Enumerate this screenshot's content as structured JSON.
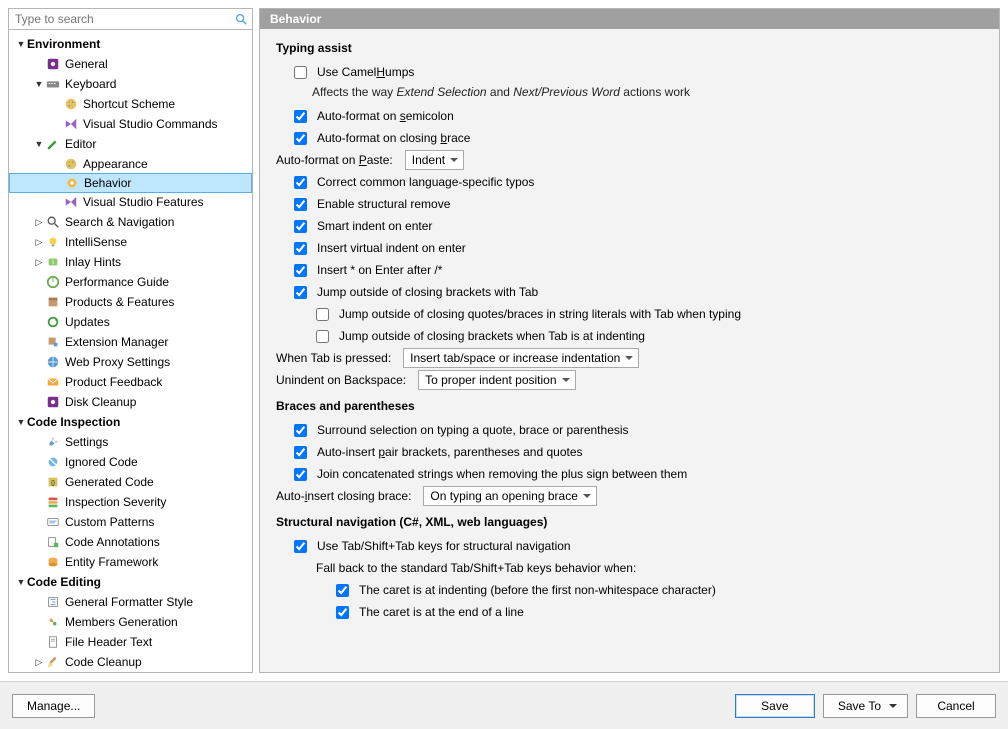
{
  "search": {
    "placeholder": "Type to search"
  },
  "header": {
    "title": "Behavior"
  },
  "tree": {
    "items": [
      {
        "level": 0,
        "arrow": "down",
        "bold": true,
        "label": "Environment",
        "icon": "none"
      },
      {
        "level": 1,
        "arrow": "none",
        "bold": false,
        "label": "General",
        "icon": "gear-red"
      },
      {
        "level": 1,
        "arrow": "down",
        "bold": false,
        "label": "Keyboard",
        "icon": "keyboard"
      },
      {
        "level": 2,
        "arrow": "none",
        "bold": false,
        "label": "Shortcut Scheme",
        "icon": "palette"
      },
      {
        "level": 2,
        "arrow": "none",
        "bold": false,
        "label": "Visual Studio Commands",
        "icon": "vs"
      },
      {
        "level": 1,
        "arrow": "down",
        "bold": false,
        "label": "Editor",
        "icon": "pencil"
      },
      {
        "level": 2,
        "arrow": "none",
        "bold": false,
        "label": "Appearance",
        "icon": "palette"
      },
      {
        "level": 2,
        "arrow": "none",
        "bold": false,
        "label": "Behavior",
        "icon": "gear-yellow",
        "selected": true
      },
      {
        "level": 2,
        "arrow": "none",
        "bold": false,
        "label": "Visual Studio Features",
        "icon": "vs"
      },
      {
        "level": 1,
        "arrow": "right",
        "bold": false,
        "label": "Search & Navigation",
        "icon": "search"
      },
      {
        "level": 1,
        "arrow": "right",
        "bold": false,
        "label": "IntelliSense",
        "icon": "bulb"
      },
      {
        "level": 1,
        "arrow": "right",
        "bold": false,
        "label": "Inlay Hints",
        "icon": "hint"
      },
      {
        "level": 1,
        "arrow": "none",
        "bold": false,
        "label": "Performance Guide",
        "icon": "perf"
      },
      {
        "level": 1,
        "arrow": "none",
        "bold": false,
        "label": "Products & Features",
        "icon": "box"
      },
      {
        "level": 1,
        "arrow": "none",
        "bold": false,
        "label": "Updates",
        "icon": "refresh"
      },
      {
        "level": 1,
        "arrow": "none",
        "bold": false,
        "label": "Extension Manager",
        "icon": "ext"
      },
      {
        "level": 1,
        "arrow": "none",
        "bold": false,
        "label": "Web Proxy Settings",
        "icon": "globe"
      },
      {
        "level": 1,
        "arrow": "none",
        "bold": false,
        "label": "Product Feedback",
        "icon": "mail"
      },
      {
        "level": 1,
        "arrow": "none",
        "bold": false,
        "label": "Disk Cleanup",
        "icon": "gear-red"
      },
      {
        "level": 0,
        "arrow": "down",
        "bold": true,
        "label": "Code Inspection",
        "icon": "none"
      },
      {
        "level": 1,
        "arrow": "none",
        "bold": false,
        "label": "Settings",
        "icon": "wrench"
      },
      {
        "level": 1,
        "arrow": "none",
        "bold": false,
        "label": "Ignored Code",
        "icon": "ignored"
      },
      {
        "level": 1,
        "arrow": "none",
        "bold": false,
        "label": "Generated Code",
        "icon": "gen"
      },
      {
        "level": 1,
        "arrow": "none",
        "bold": false,
        "label": "Inspection Severity",
        "icon": "severity"
      },
      {
        "level": 1,
        "arrow": "none",
        "bold": false,
        "label": "Custom Patterns",
        "icon": "pattern"
      },
      {
        "level": 1,
        "arrow": "none",
        "bold": false,
        "label": "Code Annotations",
        "icon": "annot"
      },
      {
        "level": 1,
        "arrow": "none",
        "bold": false,
        "label": "Entity Framework",
        "icon": "ef"
      },
      {
        "level": 0,
        "arrow": "down",
        "bold": true,
        "label": "Code Editing",
        "icon": "none"
      },
      {
        "level": 1,
        "arrow": "none",
        "bold": false,
        "label": "General Formatter Style",
        "icon": "fmt"
      },
      {
        "level": 1,
        "arrow": "none",
        "bold": false,
        "label": "Members Generation",
        "icon": "members"
      },
      {
        "level": 1,
        "arrow": "none",
        "bold": false,
        "label": "File Header Text",
        "icon": "file"
      },
      {
        "level": 1,
        "arrow": "right",
        "bold": false,
        "label": "Code Cleanup",
        "icon": "broom"
      }
    ]
  },
  "typing": {
    "heading": "Typing assist",
    "camel_pre": "Use Camel",
    "camel_u": "H",
    "camel_post": "umps",
    "camel_hint_pre": "Affects the way ",
    "camel_hint_em1": "Extend Selection",
    "camel_hint_mid": " and ",
    "camel_hint_em2": "Next/Previous Word",
    "camel_hint_post": " actions work",
    "semi_pre": "Auto-format on ",
    "semi_u": "s",
    "semi_post": "emicolon",
    "brace_pre": "Auto-format on closing ",
    "brace_u": "b",
    "brace_post": "race",
    "paste_label_pre": "Auto-format on ",
    "paste_label_u": "P",
    "paste_label_post": "aste:",
    "paste_value": "Indent",
    "typos": "Correct common language-specific typos",
    "struct_rm": "Enable structural remove",
    "smart_indent": "Smart indent on enter",
    "virtual_indent": "Insert virtual indent on enter",
    "star_enter": "Insert * on Enter after /*",
    "jump_tab": "Jump outside of closing brackets with Tab",
    "jump_tab_a": "Jump outside of closing quotes/braces in string literals with Tab when typing",
    "jump_tab_b": "Jump outside of closing brackets when Tab is at indenting",
    "tab_label": "When Tab is pressed:",
    "tab_value": "Insert tab/space or increase indentation",
    "unindent_label": "Unindent on Backspace:",
    "unindent_value": "To proper indent position"
  },
  "braces": {
    "heading": "Braces and parentheses",
    "surround": "Surround selection on typing a quote, brace or parenthesis",
    "pair_pre": "Auto-insert ",
    "pair_u": "p",
    "pair_post": "air brackets, parentheses and quotes",
    "join": "Join concatenated strings when removing the plus sign between them",
    "close_label_pre": "Auto-",
    "close_label_u": "i",
    "close_label_post": "nsert closing brace:",
    "close_value": "On typing an opening brace"
  },
  "structnav": {
    "heading": "Structural navigation (C#, XML, web languages)",
    "use": "Use Tab/Shift+Tab keys for structural navigation",
    "fallback": "Fall back to the standard Tab/Shift+Tab keys behavior when:",
    "a": "The caret is at indenting (before the first non-whitespace character)",
    "b": "The caret is at the end of a line"
  },
  "buttons": {
    "manage": "Manage...",
    "save": "Save",
    "saveto": "Save To",
    "cancel": "Cancel"
  }
}
